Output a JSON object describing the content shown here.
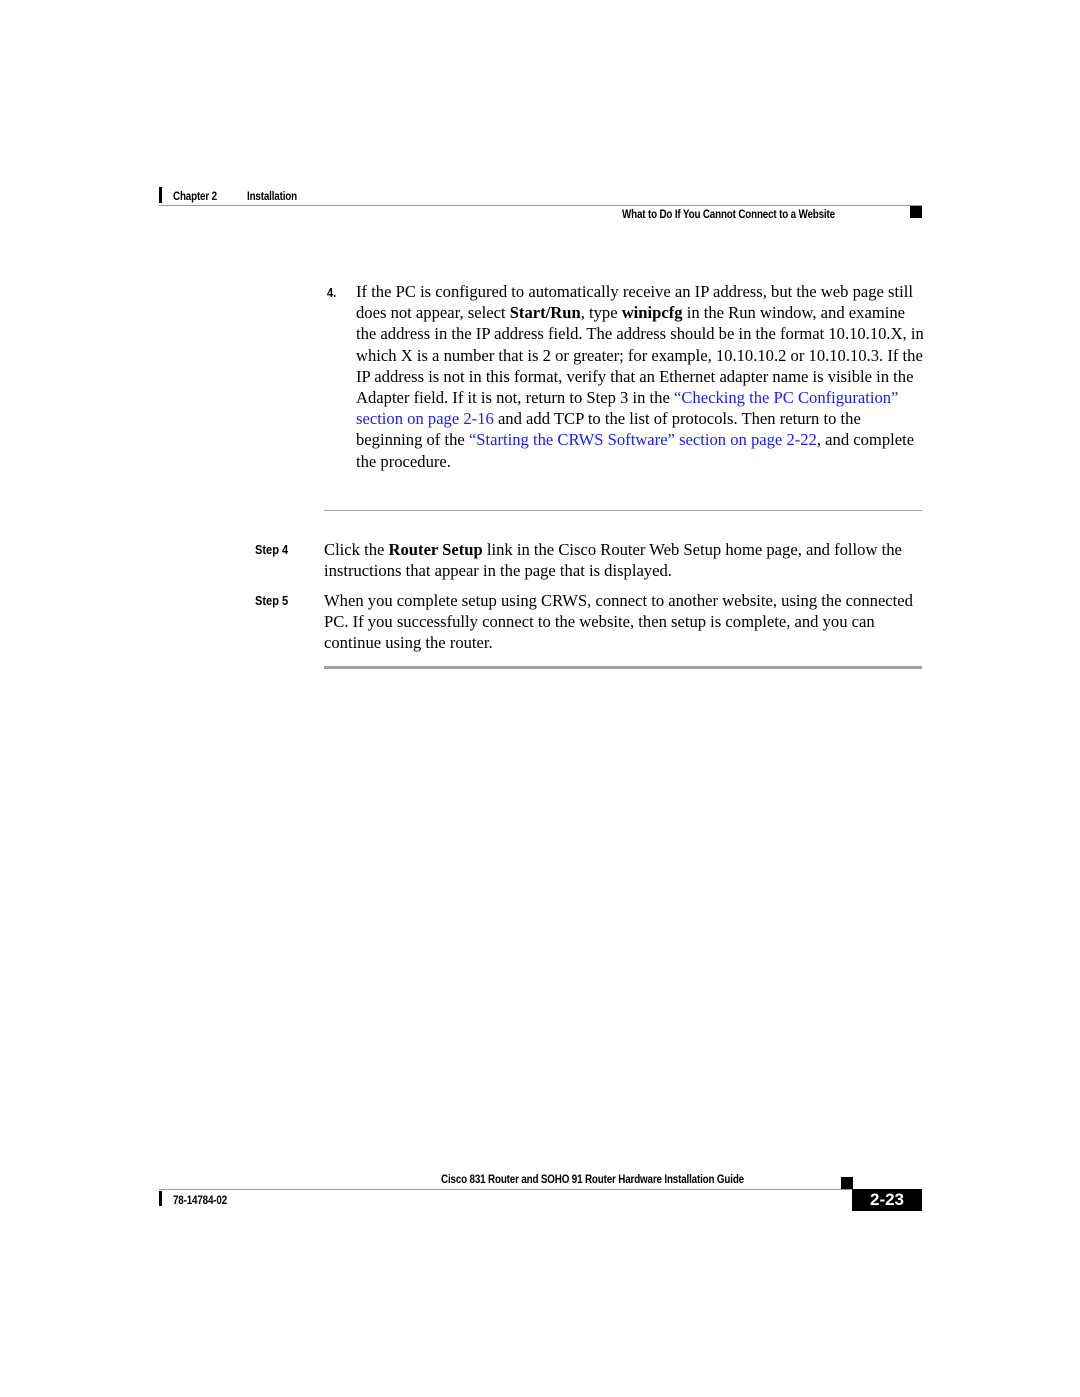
{
  "header": {
    "chapter_label": "Chapter 2",
    "chapter_title": "Installation",
    "section_title": "What to Do If You Cannot Connect to a Website"
  },
  "content": {
    "item4": {
      "number": "4.",
      "segments": {
        "s1": "If the PC is configured to automatically receive an IP address, but the web page still does not appear, select ",
        "b1": "Start/Run",
        "s2": ", type ",
        "b2": "winipcfg",
        "s3": " in the Run window, and examine the address in the IP address field. The address should be in the format 10.10.10.X, in which X is a number that is 2 or greater; for example, 10.10.10.2 or 10.10.10.3. If the IP address is not in this format, verify that an Ethernet adapter name is visible in the Adapter field. If it is not, return to Step 3 in the ",
        "link1": "“Checking the PC Configuration” section on page 2-16",
        "s4": " and add TCP to the list of protocols. Then return to the beginning of the ",
        "link2": "“Starting the CRWS Software” section on page 2-22",
        "s5": ", and complete the procedure."
      }
    },
    "steps": [
      {
        "label": "Step 4",
        "s1": "Click the ",
        "b1": "Router Setup",
        "s2": " link in the Cisco Router Web Setup home page, and follow the instructions that appear in the page that is displayed."
      },
      {
        "label": "Step 5",
        "text": "When you complete setup using CRWS, connect to another website, using the connected PC. If you successfully connect to the website, then setup is complete, and you can continue using the router."
      }
    ]
  },
  "footer": {
    "guide_title": "Cisco 831 Router and SOHO 91 Router Hardware Installation Guide",
    "doc_number": "78-14784-02",
    "page_number": "2-23"
  }
}
